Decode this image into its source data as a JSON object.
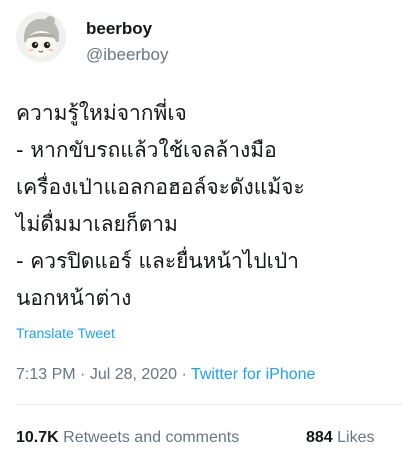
{
  "author": {
    "display_name": "beerboy",
    "handle": "@ibeerboy",
    "avatar_icon": "cartoon-face-avatar-icon"
  },
  "tweet": {
    "lines": [
      "ความรู้ใหม่จากพี่เจ",
      "- หากขับรถแล้วใช้เจลล้างมือ",
      "เครื่องเป่าแอลกอฮอล์จะดังแม้จะ",
      "ไม่ดื่มมาเลยก็ตาม",
      "- ควรปิดแอร์ และยื่นหน้าไปเป่า",
      "นอกหน้าต่าง"
    ],
    "translate_label": "Translate Tweet"
  },
  "meta": {
    "time": "7:13 PM",
    "separator": " · ",
    "date": "Jul 28, 2020",
    "source": "Twitter for iPhone"
  },
  "stats": {
    "retweets_count": "10.7K",
    "retweets_label": "Retweets and comments",
    "likes_count": "884",
    "likes_label": "Likes"
  },
  "colors": {
    "text": "#14171a",
    "secondary": "#657786",
    "accent": "#1da1f2",
    "divider": "#e6ecf0"
  }
}
